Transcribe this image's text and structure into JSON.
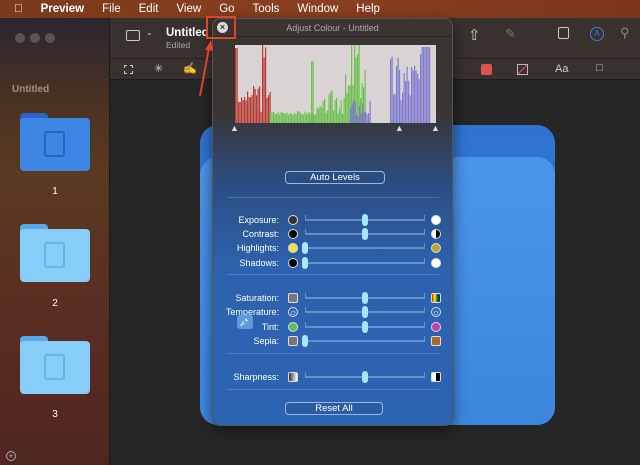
{
  "menubar": {
    "apple": "",
    "app": "Preview",
    "items": [
      "File",
      "Edit",
      "View",
      "Go",
      "Tools",
      "Window",
      "Help"
    ]
  },
  "sidebar": {
    "title": "Untitled",
    "pages": [
      "1",
      "2",
      "3"
    ],
    "add": "+"
  },
  "toolbar": {
    "title": "Untitled",
    "subtitle": "Edited",
    "font_button": "Aa"
  },
  "panel": {
    "title": "Adjust Colour - Untitled",
    "close": "×",
    "auto_levels": "Auto Levels",
    "reset_all": "Reset All",
    "sliders": [
      {
        "label": "Exposure:",
        "value": 0.5
      },
      {
        "label": "Contrast:",
        "value": 0.5
      },
      {
        "label": "Highlights:",
        "value": 0.0
      },
      {
        "label": "Shadows:",
        "value": 0.0
      },
      {
        "label": "Saturation:",
        "value": 0.5
      },
      {
        "label": "Temperature:",
        "value": 0.5
      },
      {
        "label": "Tint:",
        "value": 0.5
      },
      {
        "label": "Sepia:",
        "value": 0.0
      },
      {
        "label": "Sharpness:",
        "value": 0.5
      }
    ],
    "levels": {
      "black": 0.0,
      "mid": 0.82,
      "white": 1.0
    }
  },
  "colors": {
    "highlight": "#e0452b",
    "knob": "#a8e6ff",
    "red": "#b83a34",
    "green": "#6cc24f",
    "blue": "#7f7cd0"
  }
}
